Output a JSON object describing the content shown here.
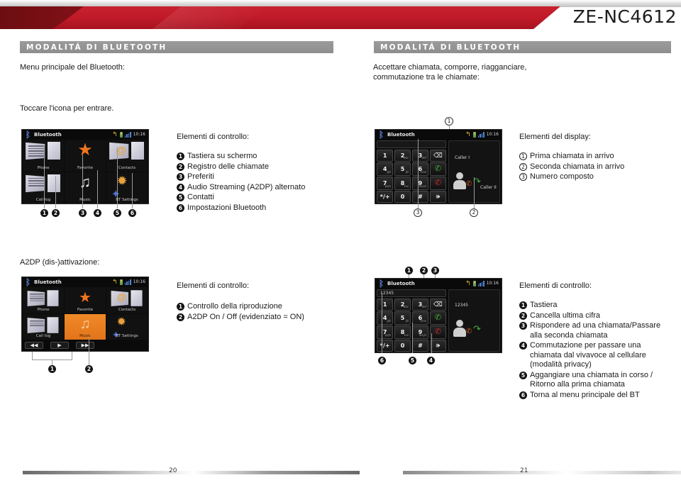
{
  "header": {
    "model": "ZE-NC4612"
  },
  "left_page": {
    "section_title": "MODALITÁ DI BLUETOOTH",
    "intro": "Menu principale del Bluetooth:",
    "instruction": "Toccare l'icona per entrare.",
    "controls_heading": "Elementi di controllo:",
    "controls": [
      {
        "n": "1",
        "label": "Tastiera su schermo"
      },
      {
        "n": "2",
        "label": "Registro delle chiamate"
      },
      {
        "n": "3",
        "label": "Preferiti"
      },
      {
        "n": "4",
        "label": "Audio Streaming (A2DP) alternato"
      },
      {
        "n": "5",
        "label": "Contatti"
      },
      {
        "n": "6",
        "label": "Impostazioni Bluetooth"
      }
    ],
    "a2dp_heading": "A2DP (dis-)attivazione:",
    "a2dp_controls_heading": "Elementi di controllo:",
    "a2dp_controls": [
      {
        "n": "1",
        "label": "Controllo della riproduzione"
      },
      {
        "n": "2",
        "label": "A2DP On / Off (evidenziato = ON)"
      }
    ],
    "page_number": "20",
    "menu_screen": {
      "status_title": "Bluetooth",
      "clock": "10:16",
      "tiles": [
        {
          "label": "Phone",
          "icon": "bookpage-icon",
          "highlight": false
        },
        {
          "label": "Favorite",
          "icon": "star-icon",
          "highlight": false
        },
        {
          "label": "Contacts",
          "icon": "at-sign-icon",
          "highlight": false
        },
        {
          "label": "Call log",
          "icon": "calllog-icon",
          "highlight": false
        },
        {
          "label": "Music",
          "icon": "music-note-icon",
          "highlight": false
        },
        {
          "label": "BT Settings",
          "icon": "gear-bluetooth-icon",
          "highlight": false
        }
      ],
      "callouts": [
        "1",
        "2",
        "3",
        "4",
        "5",
        "6"
      ]
    },
    "a2dp_screen": {
      "status_title": "Bluetooth",
      "clock": "10:16",
      "tiles": [
        {
          "label": "Phone",
          "icon": "bookpage-icon",
          "highlight": false
        },
        {
          "label": "Favorite",
          "icon": "star-icon",
          "highlight": false
        },
        {
          "label": "Contacts",
          "icon": "at-sign-icon",
          "highlight": false
        },
        {
          "label": "Call log",
          "icon": "calllog-icon",
          "highlight": false
        },
        {
          "label": "Music",
          "icon": "music-note-icon",
          "highlight": true
        },
        {
          "label": "BT Settings",
          "icon": "gear-bluetooth-icon",
          "highlight": false
        }
      ],
      "playback": [
        {
          "icon": "previous-track-icon",
          "glyph": "◀◀"
        },
        {
          "icon": "play-icon",
          "glyph": "▶"
        },
        {
          "icon": "next-track-icon",
          "glyph": "▶▶"
        }
      ],
      "callouts": [
        "1",
        "2"
      ]
    }
  },
  "right_page": {
    "section_title": "MODALITÁ DI BLUETOOTH",
    "intro_line1": "Accettare chiamata, comporre, riagganciare,",
    "intro_line2": "commutazione tra le chiamate:",
    "display_heading": "Elementi del display:",
    "display_items": [
      {
        "n": "1",
        "label": "Prima chiamata in arrivo"
      },
      {
        "n": "2",
        "label": "Seconda chiamata in arrivo"
      },
      {
        "n": "3",
        "label": "Numero composto"
      }
    ],
    "controls_heading": "Elementi di controllo:",
    "controls": [
      {
        "n": "1",
        "label": "Tastiera"
      },
      {
        "n": "2",
        "label": "Cancella ultima cifra"
      },
      {
        "n": "3",
        "label": "Rispondere ad una chiamata/Passare alla seconda chiamata"
      },
      {
        "n": "4",
        "label": "Commutazione per passare una chiamata dal vivavoce al cellulare (modalità privacy)"
      },
      {
        "n": "5",
        "label": "Aggangiare una chiamata in corso / Ritorno alla prima chiamata"
      },
      {
        "n": "6",
        "label": "Torna al menu principale del BT"
      }
    ],
    "page_number": "21",
    "call_screen_top": {
      "status_title": "Bluetooth",
      "clock": "10:16",
      "number_field": "",
      "keys": [
        {
          "big": "1",
          "sub": ""
        },
        {
          "big": "2",
          "sub": "abc"
        },
        {
          "big": "3",
          "sub": "def"
        },
        {
          "big": "del",
          "sub": ""
        },
        {
          "big": "4",
          "sub": "ghi"
        },
        {
          "big": "5",
          "sub": "jkl"
        },
        {
          "big": "6",
          "sub": "mno"
        },
        {
          "big": "answer",
          "sub": ""
        },
        {
          "big": "7",
          "sub": "pqrs"
        },
        {
          "big": "8",
          "sub": "tuv"
        },
        {
          "big": "9",
          "sub": "wxyz"
        },
        {
          "big": "hangup",
          "sub": ""
        },
        {
          "big": "*/+",
          "sub": ""
        },
        {
          "big": "0",
          "sub": ""
        },
        {
          "big": "#",
          "sub": ""
        },
        {
          "big": "speaker",
          "sub": ""
        }
      ],
      "caller1": "Caller I",
      "caller2": "Caller II",
      "callouts": [
        "1",
        "2",
        "3"
      ]
    },
    "call_screen_bottom": {
      "status_title": "Bluetooth",
      "clock": "10:16",
      "number_field": "12345",
      "dialed_number": "12345",
      "keys": [
        {
          "big": "1",
          "sub": ""
        },
        {
          "big": "2",
          "sub": "abc"
        },
        {
          "big": "3",
          "sub": "def"
        },
        {
          "big": "del",
          "sub": ""
        },
        {
          "big": "4",
          "sub": "ghi"
        },
        {
          "big": "5",
          "sub": "jkl"
        },
        {
          "big": "6",
          "sub": "mno"
        },
        {
          "big": "answer",
          "sub": ""
        },
        {
          "big": "7",
          "sub": "pqrs"
        },
        {
          "big": "8",
          "sub": "tuv"
        },
        {
          "big": "9",
          "sub": "wxyz"
        },
        {
          "big": "hangup",
          "sub": ""
        },
        {
          "big": "*/+",
          "sub": ""
        },
        {
          "big": "0",
          "sub": ""
        },
        {
          "big": "#",
          "sub": ""
        },
        {
          "big": "speaker",
          "sub": ""
        }
      ],
      "callouts_top": [
        "1",
        "2",
        "3"
      ],
      "callouts_bottom": [
        "6",
        "5",
        "4"
      ]
    }
  }
}
